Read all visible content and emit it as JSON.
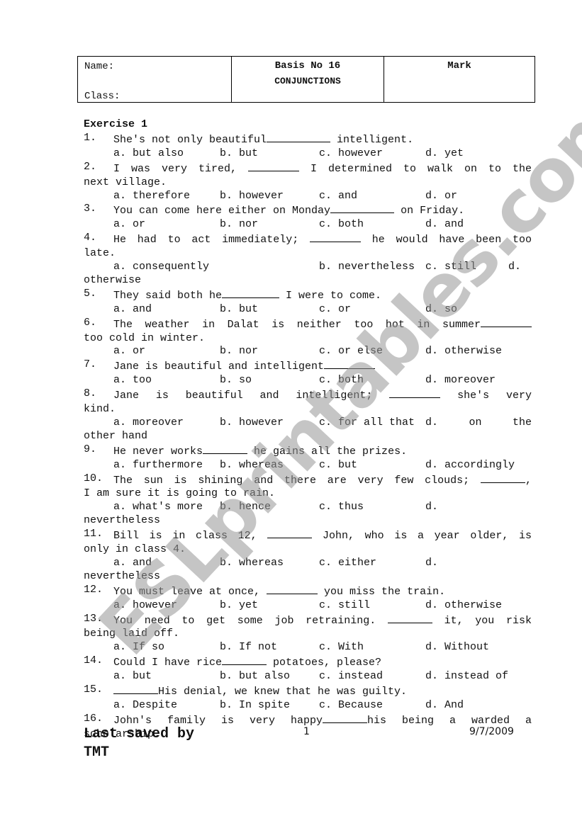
{
  "header": {
    "name_label": "Name:",
    "class_label": "Class:",
    "title": "Basis No 16",
    "subtitle": "CONJUNCTIONS",
    "mark_label": "Mark"
  },
  "exercise_title": "Exercise 1",
  "questions": [
    {
      "num": "1.",
      "lines": [
        "She's not only beautiful__________ intelligent."
      ],
      "options": [
        "a. but also",
        "b. but",
        "c. however",
        "d. yet"
      ]
    },
    {
      "num": "2.",
      "lines": [
        "I was very tired, ________ I determined to walk on to the",
        "next village."
      ],
      "options": [
        "a. therefore",
        "b. however",
        "c. and",
        "d. or"
      ]
    },
    {
      "num": "3.",
      "lines": [
        "You can come here either on Monday__________ on Friday."
      ],
      "options": [
        "a. or",
        "b. nor",
        "c. both",
        "d. and"
      ]
    },
    {
      "num": "4.",
      "lines": [
        "He had to act immediately; ________ he would have been too",
        "late."
      ],
      "options": [
        "a. consequently",
        "b. nevertheless",
        "c. still",
        "d.",
        "otherwise"
      ]
    },
    {
      "num": "5.",
      "lines": [
        "They said both he_________ I were to come."
      ],
      "options": [
        "a. and",
        "b. but",
        "c. or",
        "d. so"
      ]
    },
    {
      "num": "6.",
      "lines": [
        "The weather in Dalat is neither too hot in summer________",
        "too cold in winter."
      ],
      "options": [
        "a. or",
        "b. nor",
        "c. or else",
        "d. otherwise"
      ]
    },
    {
      "num": "7.",
      "lines": [
        "Jane is beautiful and intelligent________"
      ],
      "options": [
        "a. too",
        "b. so",
        "c. both",
        "d. moreover"
      ]
    },
    {
      "num": "8.",
      "lines": [
        "Jane is beautiful and intelligent; ________ she's very",
        "kind."
      ],
      "options": [
        "a. moreover",
        "b. however",
        "c. for all that",
        "d. on the",
        "other hand"
      ]
    },
    {
      "num": "9.",
      "lines": [
        "He never works_______ he gains all the prizes."
      ],
      "options": [
        "a. furthermore",
        "b. whereas",
        "c. but",
        "d. accordingly"
      ]
    },
    {
      "num": "10.",
      "lines": [
        "The sun is shining and there are very few clouds; _______,",
        "I am sure it is going to rain."
      ],
      "options": [
        "a. what's more",
        "b. hence",
        "c. thus",
        "d.",
        "nevertheless"
      ]
    },
    {
      "num": "11.",
      "lines": [
        "Bill is in class 12, _______ John, who is a year older, is",
        "only in class 4."
      ],
      "options": [
        "a. and",
        "b. whereas",
        "c. either",
        "d.",
        "nevertheless"
      ]
    },
    {
      "num": "12.",
      "lines": [
        "You must leave at once, ________ you miss the train."
      ],
      "options": [
        "a. however",
        "b. yet",
        "c. still",
        "d. otherwise"
      ]
    },
    {
      "num": "13.",
      "lines": [
        "You need to get some job retraining. _______ it, you risk",
        "being laid off."
      ],
      "options": [
        "a. If so",
        "b. If not",
        "c. With",
        "d. Without"
      ]
    },
    {
      "num": "14.",
      "lines": [
        "Could I have rice_______ potatoes, please?"
      ],
      "options": [
        "a. but",
        "b. but also",
        "c. instead",
        "d. instead of"
      ]
    },
    {
      "num": "15.",
      "lines": [
        "_______His denial, we knew that he was guilty."
      ],
      "options": [
        "a. Despite",
        "b. In spite",
        "c. Because",
        "d. And"
      ]
    },
    {
      "num": "16.",
      "lines": [
        "John's family is very happy_______his being a warded a",
        "scholarship."
      ],
      "options": []
    }
  ],
  "footer": {
    "saved_by_line1": "Last saved by",
    "saved_by_line2": "TMT",
    "page_number": "1",
    "date": "9/7/2009"
  },
  "watermark": "ESLprintables.com"
}
